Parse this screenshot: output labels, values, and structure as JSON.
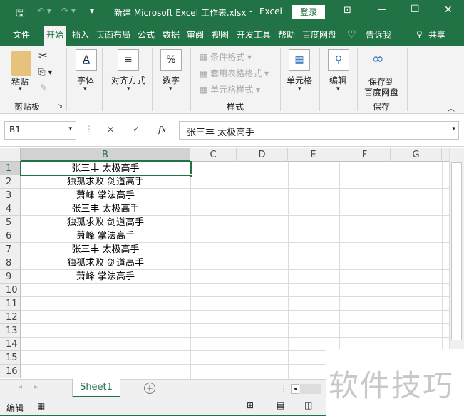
{
  "title": {
    "document": "新建 Microsoft Excel 工作表.xlsx",
    "sep": "-",
    "app": "Excel",
    "login": "登录"
  },
  "tabs": [
    "文件",
    "开始",
    "插入",
    "页面布局",
    "公式",
    "数据",
    "审阅",
    "视图",
    "开发工具",
    "帮助",
    "百度网盘",
    "告诉我",
    "共享"
  ],
  "ribbon": {
    "clipboard": {
      "paste": "粘贴",
      "group": "剪贴板"
    },
    "font": {
      "label": "字体",
      "icon": "A"
    },
    "align": {
      "label": "对齐方式",
      "icon": "≡"
    },
    "number": {
      "label": "数字",
      "icon": "%"
    },
    "styles": {
      "cond": "条件格式",
      "table": "套用表格格式",
      "cell": "单元格样式",
      "group": "样式"
    },
    "cells": {
      "label": "单元格"
    },
    "editing": {
      "label": "编辑"
    },
    "save": {
      "line1": "保存到",
      "line2": "百度网盘",
      "group": "保存"
    }
  },
  "formula": {
    "namebox": "B1",
    "cancel": "✕",
    "enter": "✓",
    "fx": "fx",
    "value": "张三丰 太极高手"
  },
  "columns": [
    "B",
    "C",
    "D",
    "E",
    "F",
    "G"
  ],
  "rows": [
    "1",
    "2",
    "3",
    "4",
    "5",
    "6",
    "7",
    "8",
    "9",
    "10",
    "11",
    "12",
    "13",
    "14",
    "15",
    "16"
  ],
  "cells_B": [
    "张三丰 太极高手",
    "独孤求败 剑道高手",
    "萧峰 掌法高手",
    "张三丰 太极高手",
    "独孤求败 剑道高手",
    "萧峰 掌法高手",
    "张三丰 太极高手",
    "独孤求败 剑道高手",
    "萧峰 掌法高手"
  ],
  "sheet": {
    "tab": "Sheet1",
    "add": "+"
  },
  "status": {
    "mode": "编辑"
  },
  "watermark": "软件技巧",
  "colors": {
    "accent": "#217346"
  }
}
